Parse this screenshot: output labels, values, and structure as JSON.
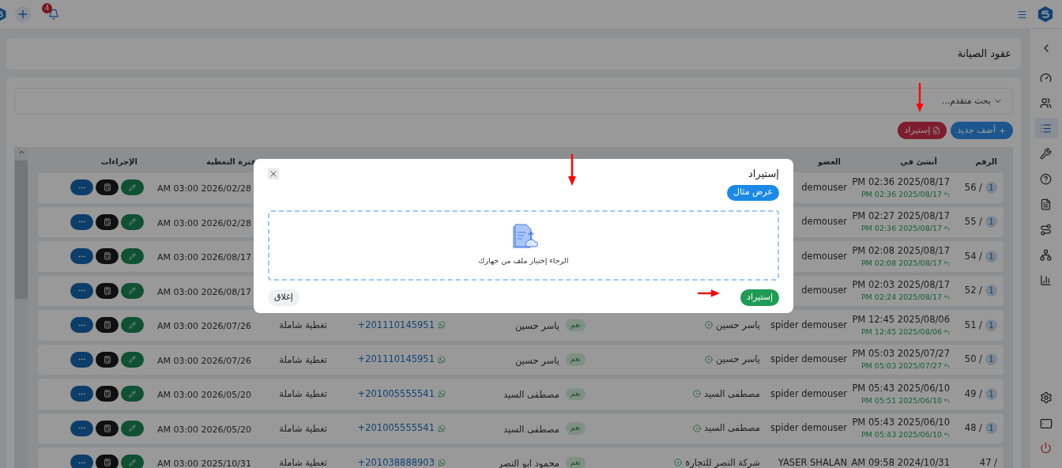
{
  "topbar": {
    "notification_count": "4"
  },
  "sidebar": {
    "items": [
      {
        "selected": false
      },
      {
        "selected": false
      },
      {
        "selected": true
      },
      {
        "selected": false
      },
      {
        "selected": false
      },
      {
        "selected": false
      },
      {
        "selected": false
      },
      {
        "selected": false
      },
      {
        "selected": false
      }
    ]
  },
  "page_title": "عقود الصيانة",
  "advanced_search": {
    "label": "بحث متقدم...",
    "expanded": false
  },
  "toolbar": {
    "buttons": [
      {
        "label": "أضف جديد",
        "kind": "add"
      },
      {
        "label": "إستيراد",
        "kind": "import"
      }
    ]
  },
  "table": {
    "columns": {
      "number": "الرقم",
      "created": "أنشئ في",
      "member": "العضو",
      "coverage_period": "فترة التغطية",
      "actions": "الإجراءات"
    },
    "rows": [
      {
        "number": "56 /",
        "revision": "1",
        "created": "PM 02:36 2025/08/17",
        "updated": "PM 02:36 2025/08/17",
        "member": "demouser",
        "period": "AM 03:00 2026/02/28"
      },
      {
        "number": "55 /",
        "revision": "1",
        "created": "PM 02:27 2025/08/17",
        "updated": "PM 02:36 2025/08/17",
        "member": "demouser",
        "period": "AM 03:00 2026/02/28"
      },
      {
        "number": "54 /",
        "revision": "1",
        "created": "PM 02:08 2025/08/17",
        "updated": "PM 02:08 2025/08/17",
        "member": "demouser",
        "period": "AM 03:00 2026/08/17"
      },
      {
        "number": "52 /",
        "revision": "1",
        "created": "PM 02:03 2025/08/17",
        "updated": "PM 02:24 2025/08/17",
        "member": "demouser",
        "period": "AM 03:00 2026/08/17"
      },
      {
        "number": "51 /",
        "revision": "1",
        "created": "PM 12:45 2025/08/06",
        "updated": "PM 12:45 2025/08/06",
        "member": "spider demouser",
        "client": "ياسر حسين",
        "active": "نعم",
        "name": "ياسر حسين",
        "phone": "+201110145951",
        "coverage": "تغطية شاملة",
        "period": "AM 03:00 2026/07/26"
      },
      {
        "number": "50 /",
        "revision": "1",
        "created": "PM 05:03 2025/07/27",
        "updated": "PM 05:03 2025/07/27",
        "member": "spider demouser",
        "client": "ياسر حسين",
        "active": "نعم",
        "name": "ياسر حسين",
        "phone": "+201110145951",
        "coverage": "تغطية شاملة",
        "period": "AM 03:00 2026/07/26"
      },
      {
        "number": "49 /",
        "revision": "1",
        "created": "PM 05:43 2025/06/10",
        "updated": "PM 05:51 2025/06/10",
        "member": "spider demouser",
        "client": "مصطفى السيد",
        "active": "نعم",
        "name": "مصطفى السيد",
        "phone": "+201005555541",
        "coverage": "تغطية شاملة",
        "period": "AM 03:00 2026/05/20"
      },
      {
        "number": "48 /",
        "revision": "1",
        "created": "PM 05:43 2025/06/10",
        "updated": "PM 05:43 2025/06/10",
        "member": "spider demouser",
        "client": "مصطفى السيد",
        "active": "نعم",
        "name": "مصطفى السيد",
        "phone": "+201005555541",
        "coverage": "تغطية شاملة",
        "period": "AM 03:00 2026/05/20"
      },
      {
        "number": "47 /",
        "created": "AM 09:58 2024/10/31",
        "member": "YASER SHALAN",
        "client": "شركة النصر للتجارة",
        "active": "نعم",
        "name": "محمود ابو النصر",
        "phone": "+201038888903",
        "coverage": "تغطية شاملة",
        "period": "AM 03:00 2025/10/31"
      }
    ]
  },
  "modal": {
    "title": "إستيراد",
    "example_button": "عرض مثال",
    "dropzone_hint": "الرجاء إختيار ملف من جهازك",
    "submit": "إستيراد",
    "close": "إغلاق"
  }
}
